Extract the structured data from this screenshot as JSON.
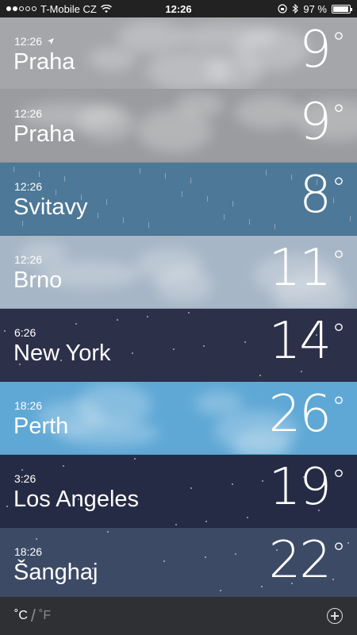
{
  "status_bar": {
    "carrier": "T-Mobile CZ",
    "time": "12:26",
    "battery": "97 %",
    "battery_level": 0.97,
    "signal_bars_filled": 2,
    "signal_bars_total": 5
  },
  "cities": [
    {
      "time": "12:26",
      "city": "Praha",
      "temp": "9",
      "current_location": true,
      "bg": "#a4a6aa"
    },
    {
      "time": "12:26",
      "city": "Praha",
      "temp": "9",
      "current_location": false,
      "bg": "#9a9c9f"
    },
    {
      "time": "12:26",
      "city": "Svitavy",
      "temp": "8",
      "current_location": false,
      "bg": "#4e7897"
    },
    {
      "time": "12:26",
      "city": "Brno",
      "temp": "11",
      "current_location": false,
      "bg": "#a7b6c6"
    },
    {
      "time": "6:26",
      "city": "New York",
      "temp": "14",
      "current_location": false,
      "bg": "#2c3049"
    },
    {
      "time": "18:26",
      "city": "Perth",
      "temp": "26",
      "current_location": false,
      "bg": "#5fa8d6"
    },
    {
      "time": "3:26",
      "city": "Los Angeles",
      "temp": "19",
      "current_location": false,
      "bg": "#262b45"
    },
    {
      "time": "18:26",
      "city": "Šanghaj",
      "temp": "22",
      "current_location": false,
      "bg": "#3c4a66"
    }
  ],
  "degree_symbol": "°",
  "bottom_bar": {
    "unit_c": "˚C",
    "separator": "/",
    "unit_f": "˚F"
  }
}
